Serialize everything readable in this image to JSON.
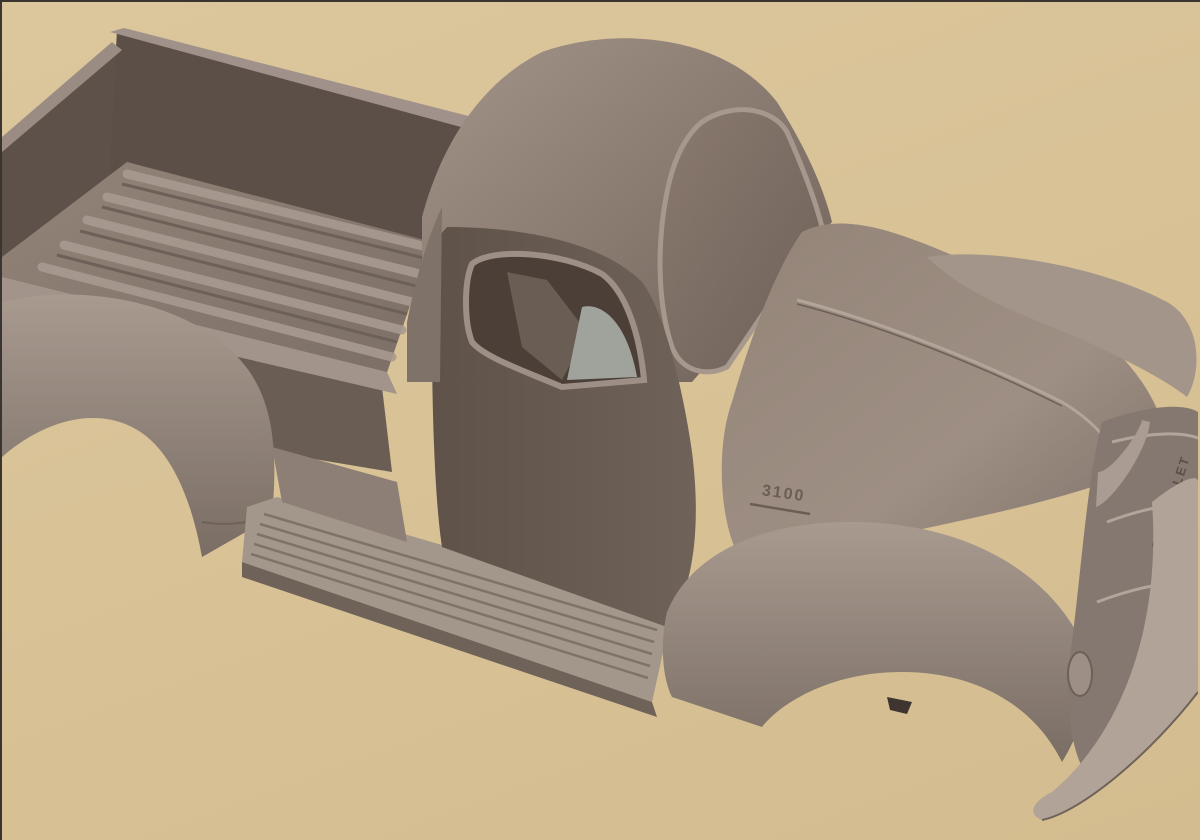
{
  "viewport": {
    "background_color": "#d7c195",
    "model_color": "#8b7d74"
  },
  "model": {
    "hood_emblem": "3100",
    "grille_emblem": "CHEVROLET"
  }
}
